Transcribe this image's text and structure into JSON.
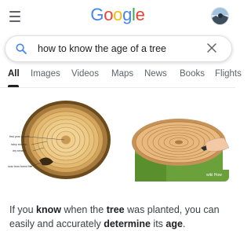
{
  "header": {
    "logo_letters": [
      {
        "ch": "G",
        "color": "#4285F4"
      },
      {
        "ch": "o",
        "color": "#EA4335"
      },
      {
        "ch": "o",
        "color": "#FBBC05"
      },
      {
        "ch": "g",
        "color": "#4285F4"
      },
      {
        "ch": "l",
        "color": "#34A853"
      },
      {
        "ch": "e",
        "color": "#EA4335"
      }
    ],
    "menu_icon": "hamburger-menu-icon",
    "avatar_icon": "user-avatar"
  },
  "search": {
    "query": "how to know the age of a tree",
    "search_icon": "search-icon",
    "clear_icon": "close-icon"
  },
  "tabs": [
    {
      "label": "All",
      "active": true
    },
    {
      "label": "Images",
      "active": false
    },
    {
      "label": "Videos",
      "active": false
    },
    {
      "label": "Maps",
      "active": false
    },
    {
      "label": "News",
      "active": false
    },
    {
      "label": "Books",
      "active": false
    },
    {
      "label": "Flights",
      "active": false
    }
  ],
  "images": {
    "image1_labels": {
      "first": "first year growth",
      "rainy": "rainy season",
      "dry": "dry season",
      "scar": "scar from forest fire"
    },
    "image2_badge": "wiki How"
  },
  "snippet": {
    "p1": "If you ",
    "b1": "know",
    "p2": " when the ",
    "b2": "tree",
    "p3": " was planted, you can easily and accurately ",
    "b3": "determine",
    "p4": " its ",
    "b4": "age",
    "p5": "."
  },
  "colors": {
    "accent": "#1a73e8",
    "text": "#202124",
    "muted": "#5f6368"
  }
}
